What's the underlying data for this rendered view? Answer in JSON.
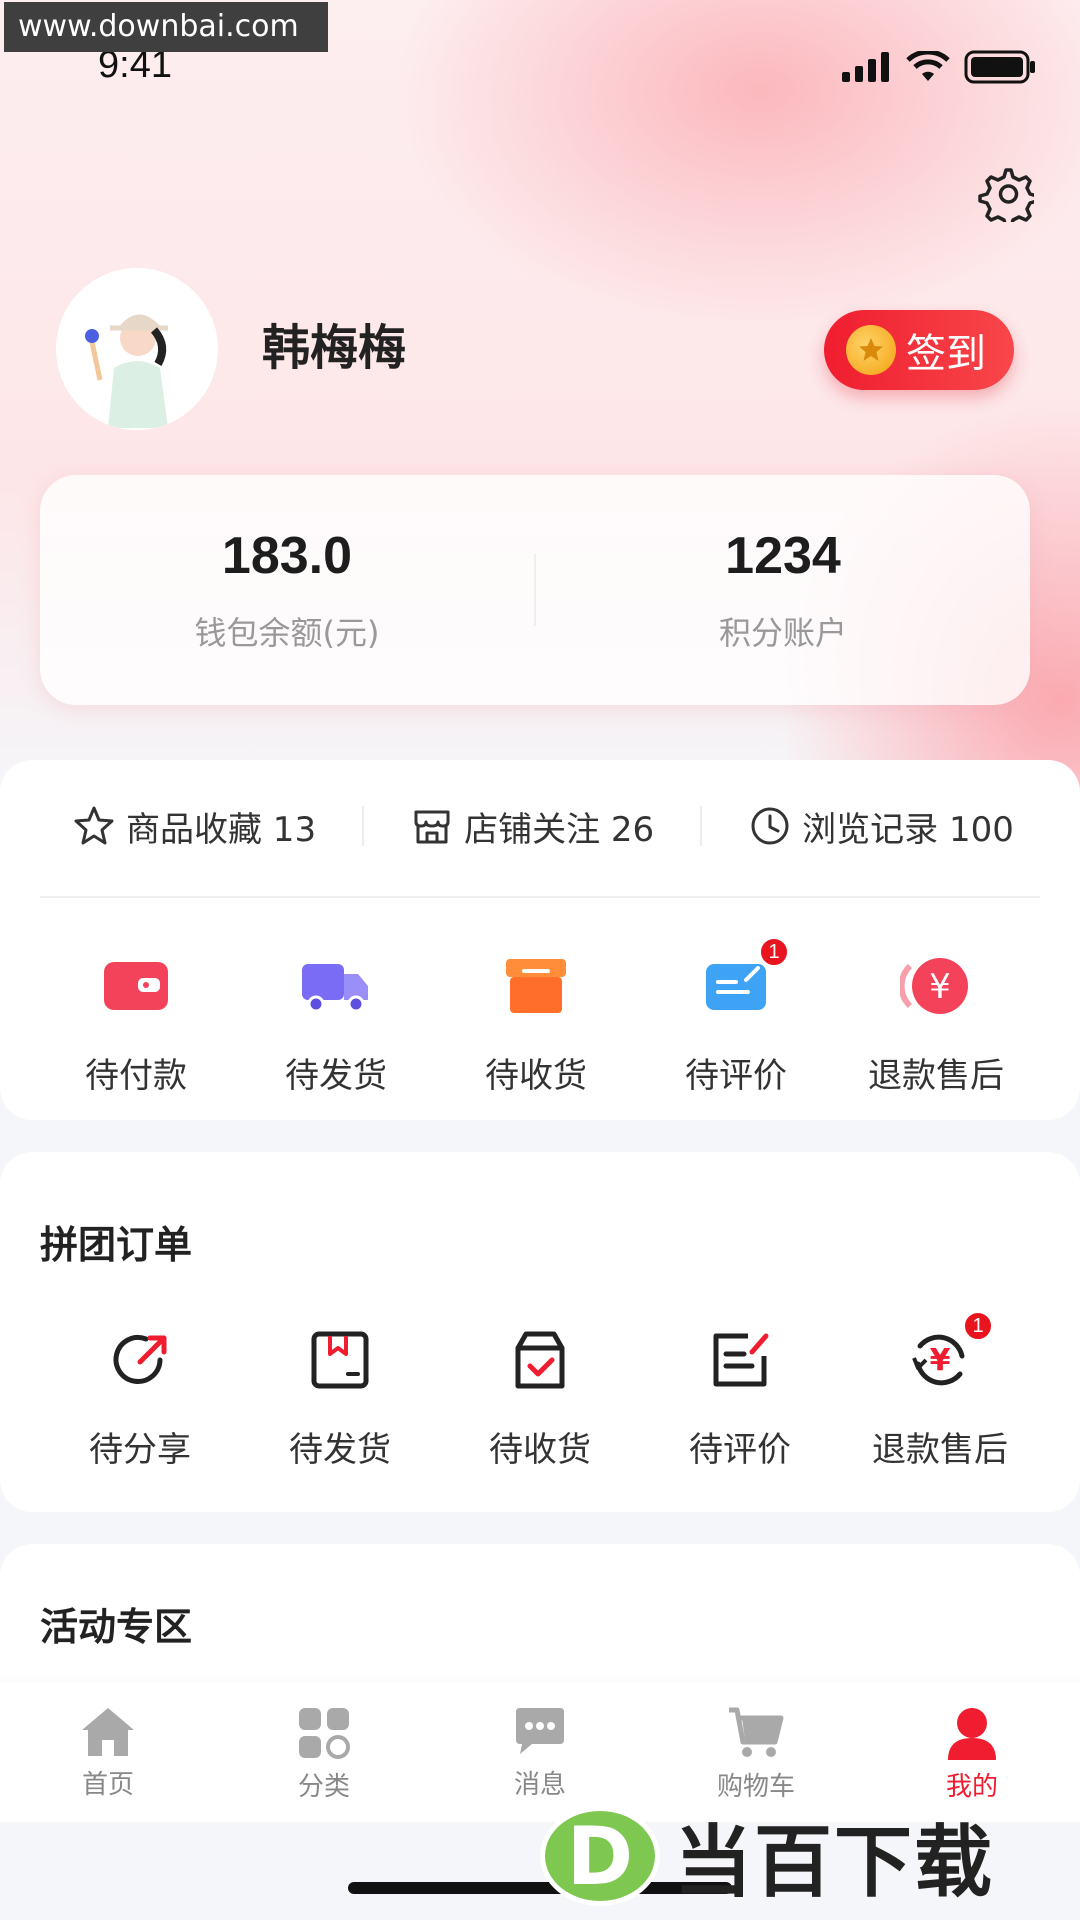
{
  "watermark_top": "www.downbai.com",
  "status_bar": {
    "time": "9:41"
  },
  "profile": {
    "username": "韩梅梅",
    "signin_label": "签到"
  },
  "wallet": {
    "balance_value": "183.0",
    "balance_label": "钱包余额(元)",
    "points_value": "1234",
    "points_label": "积分账户"
  },
  "stats": [
    {
      "label": "商品收藏 13",
      "icon": "star-icon"
    },
    {
      "label": "店铺关注 26",
      "icon": "store-icon"
    },
    {
      "label": "浏览记录 100",
      "icon": "clock-icon"
    }
  ],
  "orders": [
    {
      "label": "待付款",
      "icon": "wallet-icon",
      "color": "#f2435a"
    },
    {
      "label": "待发货",
      "icon": "truck-icon",
      "color": "#7b6cf6"
    },
    {
      "label": "待收货",
      "icon": "box-icon",
      "color": "#ff7a2f"
    },
    {
      "label": "待评价",
      "icon": "comment-icon",
      "color": "#3ea3f4",
      "badge": "1"
    },
    {
      "label": "退款售后",
      "icon": "refund-icon",
      "color": "#f4425a"
    }
  ],
  "group_orders": {
    "title": "拼团订单",
    "items": [
      {
        "label": "待分享",
        "icon": "share-icon"
      },
      {
        "label": "待发货",
        "icon": "package-icon"
      },
      {
        "label": "待收货",
        "icon": "receive-icon"
      },
      {
        "label": "待评价",
        "icon": "review-icon"
      },
      {
        "label": "退款售后",
        "icon": "refund-cycle-icon",
        "badge": "1"
      }
    ]
  },
  "activity": {
    "title": "活动专区"
  },
  "tabbar": [
    {
      "label": "首页",
      "icon": "home-icon"
    },
    {
      "label": "分类",
      "icon": "grid-icon"
    },
    {
      "label": "消息",
      "icon": "message-icon"
    },
    {
      "label": "购物车",
      "icon": "cart-icon"
    },
    {
      "label": "我的",
      "icon": "user-icon",
      "active": true
    }
  ],
  "logo_watermark": {
    "letter": "D",
    "text": "当百下载"
  },
  "colors": {
    "accent": "#ef1d2f",
    "background": "#f5f6f9"
  }
}
